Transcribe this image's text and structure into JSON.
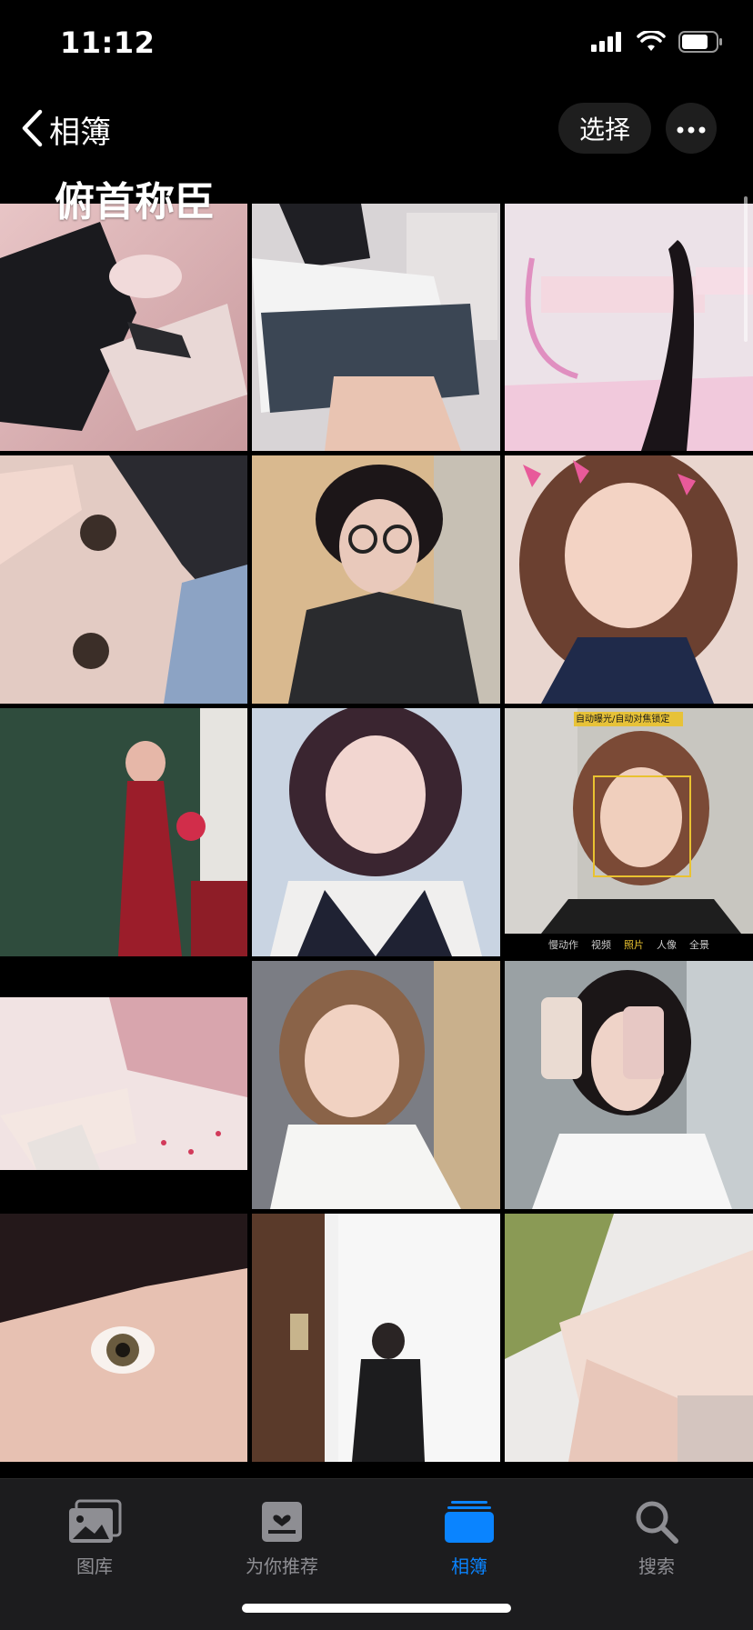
{
  "status": {
    "time": "11:12"
  },
  "nav": {
    "back_label": "相簿",
    "select_label": "选择"
  },
  "album": {
    "title": "俯首称臣"
  },
  "photos": [
    {
      "description": "girl in school uniform lying on pink bed"
    },
    {
      "description": "girl in plaid skirt sitting"
    },
    {
      "description": "pink room with hair and heart sticker"
    },
    {
      "description": "close-up of eyes covered by hand"
    },
    {
      "description": "girl with glasses and black hoodie"
    },
    {
      "description": "girl with butterfly hair clips"
    },
    {
      "description": "girl in red dress holding roses"
    },
    {
      "description": "girl with wavy hair and white collar"
    },
    {
      "description": "camera screen portrait with focus box"
    },
    {
      "description": "legs with lace socks on patterned bed"
    },
    {
      "description": "girl with bob haircut selfie"
    },
    {
      "description": "two girls taking mirror selfie"
    },
    {
      "description": "close-up of eye"
    },
    {
      "description": "mirror selfie by door"
    },
    {
      "description": "legs on white bed"
    }
  ],
  "camera_overlay": {
    "top_label": "自动曝光/自动对焦锁定",
    "modes": [
      "慢动作",
      "视频",
      "照片",
      "人像",
      "全景"
    ]
  },
  "tabs": [
    {
      "label": "图库",
      "icon": "photo-library-icon",
      "active": false
    },
    {
      "label": "为你推荐",
      "icon": "for-you-icon",
      "active": false
    },
    {
      "label": "相簿",
      "icon": "albums-icon",
      "active": true
    },
    {
      "label": "搜索",
      "icon": "search-icon",
      "active": false
    }
  ],
  "colors": {
    "accent": "#0a84ff",
    "inactive": "#8e8e93",
    "background": "#000000"
  }
}
